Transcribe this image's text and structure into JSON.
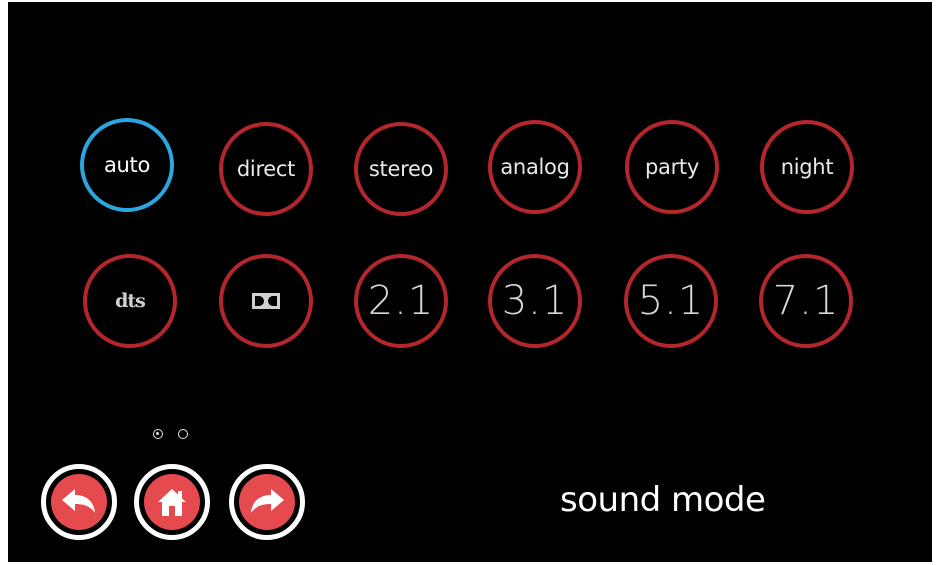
{
  "screen": {
    "title": "sound mode"
  },
  "modes_row1": [
    {
      "label": "auto",
      "selected": true
    },
    {
      "label": "direct",
      "selected": false
    },
    {
      "label": "stereo",
      "selected": false
    },
    {
      "label": "analog",
      "selected": false
    },
    {
      "label": "party",
      "selected": false
    },
    {
      "label": "night",
      "selected": false
    }
  ],
  "modes_row2": [
    {
      "label": "dts",
      "icon": "dts-logo-icon"
    },
    {
      "label": "DD",
      "icon": "dolby-logo-icon"
    },
    {
      "label": "2.1"
    },
    {
      "label": "3.1"
    },
    {
      "label": "5.1"
    },
    {
      "label": "7.1"
    }
  ],
  "pager": {
    "pages": 2,
    "current": 1
  },
  "nav": {
    "back_icon": "back-arrow-icon",
    "home_icon": "home-icon",
    "forward_icon": "forward-arrow-icon"
  },
  "colors": {
    "background": "#000000",
    "ring": "#b3262b",
    "ring_active": "#2aa7e1",
    "nav_fill": "#e54a4f",
    "text": "#e8e8e8"
  }
}
